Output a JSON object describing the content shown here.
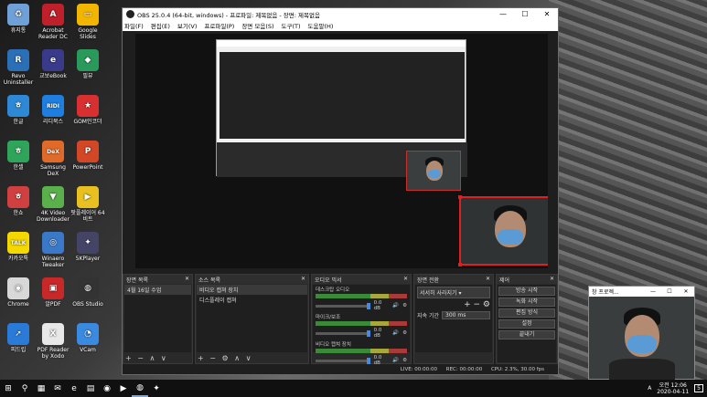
{
  "desktop_icons": [
    {
      "label": "휴지통",
      "color": "#6fa0d8",
      "glyph": "♻",
      "col": 0,
      "row": 0
    },
    {
      "label": "Acrobat Reader DC",
      "color": "#c0202a",
      "glyph": "A",
      "col": 1,
      "row": 0
    },
    {
      "label": "Google Slides",
      "color": "#f2b600",
      "glyph": "▭",
      "col": 2,
      "row": 0
    },
    {
      "label": "Revo Uninstaller",
      "color": "#2b6fb6",
      "glyph": "R",
      "col": 0,
      "row": 1
    },
    {
      "label": "교보eBook",
      "color": "#3a3a8a",
      "glyph": "e",
      "col": 1,
      "row": 1
    },
    {
      "label": "필뷰",
      "color": "#2a9a5a",
      "glyph": "◆",
      "col": 2,
      "row": 1
    },
    {
      "label": "한글",
      "color": "#2d89d5",
      "glyph": "ㅎ",
      "col": 0,
      "row": 2
    },
    {
      "label": "리디북스",
      "color": "#1e7fe0",
      "glyph": "RIDI",
      "col": 1,
      "row": 2
    },
    {
      "label": "GOM인코더",
      "color": "#d83030",
      "glyph": "★",
      "col": 2,
      "row": 2
    },
    {
      "label": "한셀",
      "color": "#2ea55a",
      "glyph": "ㅎ",
      "col": 0,
      "row": 3
    },
    {
      "label": "Samsung DeX",
      "color": "#e06a2a",
      "glyph": "DeX",
      "col": 1,
      "row": 3
    },
    {
      "label": "PowerPoint",
      "color": "#d24726",
      "glyph": "P",
      "col": 2,
      "row": 3
    },
    {
      "label": "한쇼",
      "color": "#d04040",
      "glyph": "ㅎ",
      "col": 0,
      "row": 4
    },
    {
      "label": "4K Video Downloader",
      "color": "#5ab04a",
      "glyph": "▼",
      "col": 1,
      "row": 4
    },
    {
      "label": "팟플레이어 64 비트",
      "color": "#e8c020",
      "glyph": "▶",
      "col": 2,
      "row": 4
    },
    {
      "label": "카카오톡",
      "color": "#f5d800",
      "glyph": "TALK",
      "col": 0,
      "row": 5
    },
    {
      "label": "Winaero Tweaker",
      "color": "#3a78c8",
      "glyph": "◎",
      "col": 1,
      "row": 5
    },
    {
      "label": "5KPlayer",
      "color": "#444466",
      "glyph": "✦",
      "col": 2,
      "row": 5
    },
    {
      "label": "Chrome",
      "color": "#d8d8d8",
      "glyph": "◉",
      "col": 0,
      "row": 6
    },
    {
      "label": "알PDF",
      "color": "#c82828",
      "glyph": "▣",
      "col": 1,
      "row": 6
    },
    {
      "label": "OBS Studio",
      "color": "#333333",
      "glyph": "◍",
      "col": 2,
      "row": 6
    },
    {
      "label": "피드립",
      "color": "#2a7ad8",
      "glyph": "➚",
      "col": 0,
      "row": 7
    },
    {
      "label": "PDF Reader by Xodo",
      "color": "#e8e8e8",
      "glyph": "X",
      "col": 1,
      "row": 7
    },
    {
      "label": "VCam",
      "color": "#3a8ae0",
      "glyph": "◔",
      "col": 2,
      "row": 7
    }
  ],
  "obs": {
    "title": "OBS 25.0.4 (64-bit, windows) - 프로파일: 제목없음 - 장면: 제목없음",
    "window_controls": [
      "—",
      "☐",
      "✕"
    ],
    "menu": [
      "파일(F)",
      "편집(E)",
      "보기(V)",
      "프로파일(P)",
      "장면 모음(S)",
      "도구(T)",
      "도움말(H)"
    ],
    "panels": {
      "scenes": {
        "title": "장면 목록",
        "items": [
          "4월 16일 수업"
        ],
        "footer": "+ − ∧ ∨"
      },
      "sources": {
        "title": "소스 목록",
        "items": [
          {
            "label": "비디오 캡쳐 장치"
          },
          {
            "label": "디스플레이 캡쳐"
          }
        ],
        "footer": "+ − ⚙ ∧ ∨"
      },
      "mixer": {
        "title": "오디오 믹서",
        "channels": [
          {
            "name": "마이크/보조",
            "db": "0.0 dB"
          },
          {
            "name": "데스크탑 오디오",
            "db": "0.0 dB"
          },
          {
            "name": "비디오 캡쳐 장치",
            "db": "0.0 dB"
          }
        ]
      },
      "transitions": {
        "title": "장면 전환",
        "type": "서서히 사라지기",
        "duration_label": "지속 기간",
        "duration": "300 ms"
      },
      "controls": {
        "title": "제어",
        "buttons": [
          "방송 시작",
          "녹화 시작",
          "편집 방식",
          "설정",
          "끝내기"
        ]
      }
    },
    "status": {
      "live": "LIVE: 00:00:00",
      "rec": "REC: 00:00:00",
      "cpu": "CPU: 2.3%, 30.00 fps"
    },
    "close_glyph": "✕"
  },
  "camera_window": {
    "title": "창 프로젝...",
    "controls": [
      "—",
      "☐",
      "✕"
    ]
  },
  "taskbar": {
    "icons": [
      "⊞",
      "⚲",
      "▦",
      "✉",
      "e",
      "▤",
      "◉",
      "▶",
      "◍",
      "✦"
    ],
    "tray": {
      "lang": "A",
      "time": "오전 12:06",
      "date": "2020-04-11",
      "notif": "5"
    }
  }
}
